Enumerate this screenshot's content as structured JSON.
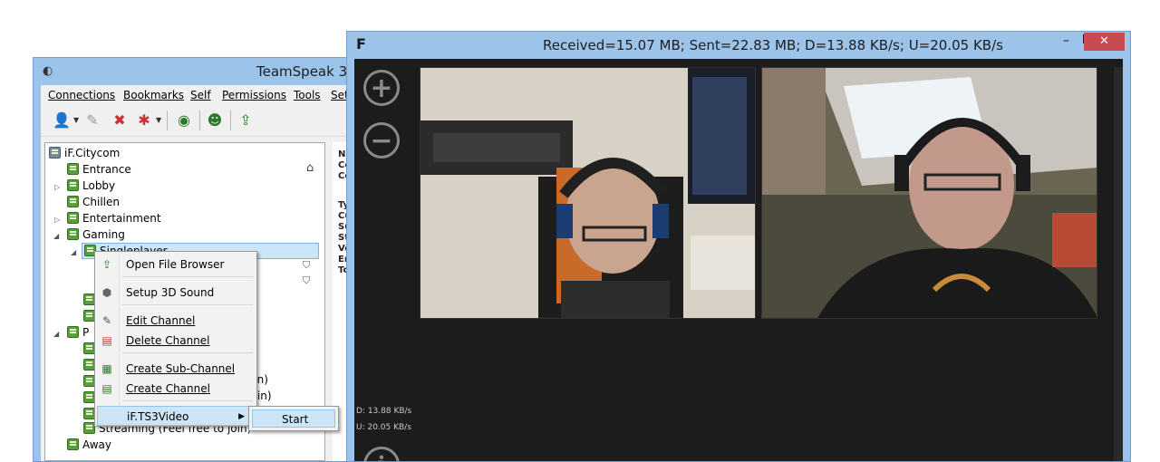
{
  "teamspeak": {
    "title": "TeamSpeak 3",
    "menu": [
      "Connections",
      "Bookmarks",
      "Self",
      "Permissions",
      "Tools",
      "Set"
    ],
    "tree": {
      "server": "iF.Citycom",
      "channels": [
        {
          "label": "Entrance"
        },
        {
          "label": "Lobby"
        },
        {
          "label": "Chillen"
        },
        {
          "label": "Entertainment"
        },
        {
          "label": "Gaming"
        },
        {
          "label": "Singleplayer"
        },
        {
          "label": "Streaming (Feel free to join)"
        },
        {
          "label": "Away"
        }
      ],
      "partial": {
        "p": "P",
        "join1": "oin)",
        "join2": "Join)"
      }
    },
    "info_labels": [
      "Na",
      "Co",
      "Co",
      "Ty",
      "Cu",
      "Su",
      "St",
      "Ve",
      "En",
      "To"
    ]
  },
  "context_menu": {
    "items": [
      {
        "label": "Open File Browser",
        "icon": "folder-icon"
      },
      {
        "label": "Setup 3D Sound",
        "icon": "cube-icon"
      },
      {
        "label": "Edit Channel",
        "icon": "edit-icon"
      },
      {
        "label": "Delete Channel",
        "icon": "delete-icon"
      },
      {
        "label": "Create Sub-Channel",
        "icon": "create-sub-icon"
      },
      {
        "label": "Create Channel",
        "icon": "create-icon"
      },
      {
        "label": "iF.TS3Video",
        "icon": ""
      }
    ],
    "submenu": {
      "start": "Start"
    }
  },
  "video_window": {
    "title": "Received=15.07 MB; Sent=22.83 MB; D=13.88 KB/s; U=20.05 KB/s",
    "logo": "F",
    "stats": {
      "download": "D: 13.88 KB/s",
      "upload": "U: 20.05 KB/s"
    },
    "buttons": {
      "zoom_in": "+",
      "zoom_out": "−",
      "info": "i",
      "close": "✕",
      "minimize": "–"
    }
  },
  "colors": {
    "titlebar": "#9cc3ea",
    "close": "#c74b50",
    "video_bg": "#1c1c1c",
    "highlight": "#cde6f7"
  }
}
